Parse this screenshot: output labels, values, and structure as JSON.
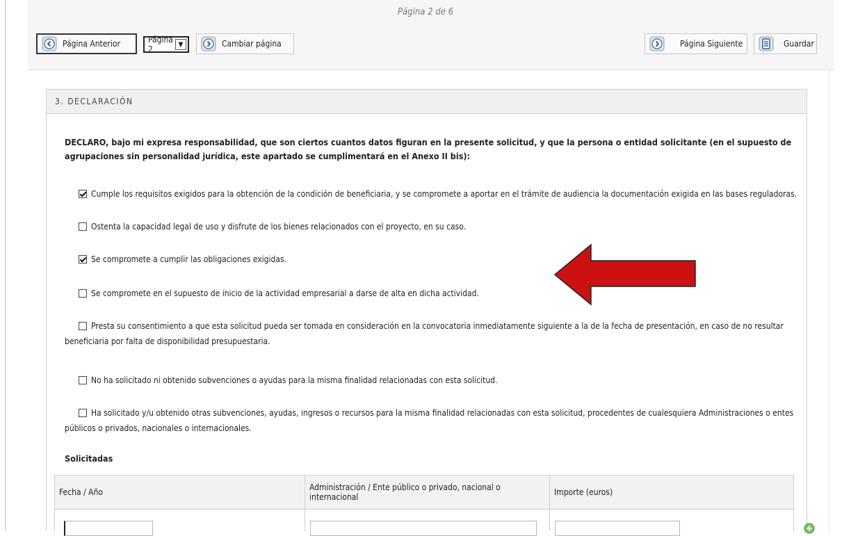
{
  "pagination": {
    "info": "Página 2 de 6"
  },
  "toolbar": {
    "prev_label": "Página Anterior",
    "page_select_value": "Página 2",
    "change_label": "Cambiar página",
    "next_label": "Página Siguiente",
    "save_label": "Guardar"
  },
  "section": {
    "title": "3. DECLARACIÓN",
    "declaration": "DECLARO, bajo mi expresa responsabilidad, que son ciertos cuantos datos figuran en la presente solicitud, y que la persona o entidad solicitante (en el supuesto de agrupaciones sin personalidad jurídica, este apartado se cumplimentará en el Anexo II bis):",
    "items": [
      {
        "text": "Cumple los requisitos exigidos para la obtención de la condición de beneficiaria, y se compromete a aportar en el trámite de audiencia la documentación exigida en las bases reguladoras.",
        "checked": true
      },
      {
        "text": "Ostenta la capacidad legal de uso y disfrute de los bienes relacionados con el proyecto, en su caso.",
        "checked": false
      },
      {
        "text": "Se compromete a cumplir las obligaciones exigidas.",
        "checked": true
      },
      {
        "text": "Se compromete en el supuesto de inicio de la actividad empresarial a darse de alta en dicha actividad.",
        "checked": false
      },
      {
        "text": "Presta su consentimiento a que esta solicitud pueda ser tomada en consideración en la convocatoria inmediatamente siguiente a la de la fecha de presentación, en caso de no resultar beneficiaria por falta de disponibilidad presupuestaria.",
        "checked": false
      },
      {
        "text": "No ha solicitado ni obtenido subvenciones o ayudas para la misma finalidad relacionadas con esta solicitud.",
        "checked": false
      },
      {
        "text": "Ha solicitado y/u obtenido otras subvenciones, ayudas, ingresos o recursos para la misma finalidad relacionadas con esta solicitud, procedentes de cualesquiera Administraciones o entes públicos o privados, nacionales o internacionales.",
        "checked": false
      }
    ],
    "solicitadas_label": "Solicitadas",
    "table": {
      "headers": [
        "Fecha / Año",
        "Administración / Ente público o privado, nacional o internacional",
        "Importe (euros)"
      ]
    }
  },
  "colors": {
    "arrow": "#cc1111",
    "arrow_stroke": "#222222"
  },
  "icons": {
    "nav": "circle-arrow-icon",
    "save": "save-icon",
    "add": "add-row-icon"
  }
}
